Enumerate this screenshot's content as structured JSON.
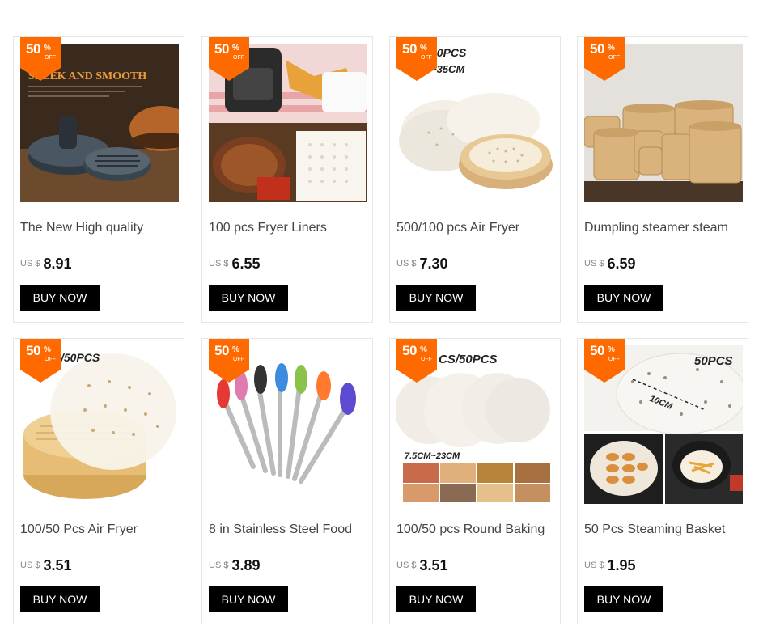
{
  "badge": {
    "number": "50",
    "percent": "%",
    "off": "OFF"
  },
  "currency": "US $",
  "buy_label": "BUY NOW",
  "products": [
    {
      "title": "The New High quality",
      "price": "8.91",
      "image_text": "SLEEK AND SMOOTH",
      "image_icon": "burger-press-image"
    },
    {
      "title": "100 pcs Fryer Liners",
      "price": "6.55",
      "image_text": "",
      "image_icon": "air-fryer-liners-image"
    },
    {
      "title": "500/100 pcs Air Fryer",
      "price": "7.30",
      "image_text": "00PCS ~35CM",
      "image_icon": "steamer-paper-image"
    },
    {
      "title": "Dumpling steamer steam",
      "price": "6.59",
      "image_text": "",
      "image_icon": "bamboo-steamers-image"
    },
    {
      "title": "100/50 Pcs Air Fryer",
      "price": "3.51",
      "image_text": "/50PCS",
      "image_icon": "steamer-liner-image"
    },
    {
      "title": "8 in Stainless Steel Food",
      "price": "3.89",
      "image_text": "",
      "image_icon": "silicone-tongs-image"
    },
    {
      "title": "100/50 pcs Round Baking",
      "price": "3.51",
      "image_text": "CS/50PCS 7.5CM~23CM",
      "image_icon": "round-baking-paper-image"
    },
    {
      "title": "50 Pcs Steaming Basket",
      "price": "1.95",
      "image_text": "50PCS 10CM",
      "image_icon": "steaming-basket-paper-image"
    }
  ]
}
